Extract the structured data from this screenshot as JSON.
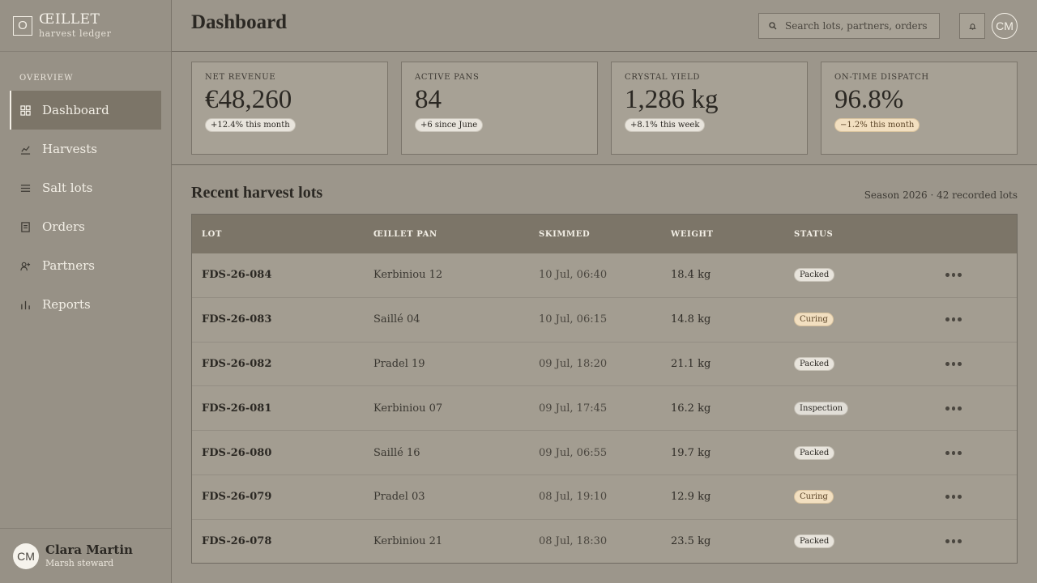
{
  "brand": {
    "mark": "O",
    "name": "ŒILLET",
    "sub": "harvest ledger"
  },
  "sidebar": {
    "section": "OVERVIEW",
    "items": [
      {
        "label": "Dashboard",
        "icon": "grid-icon",
        "active": true
      },
      {
        "label": "Harvests",
        "icon": "trend-chart-icon"
      },
      {
        "label": "Salt lots",
        "icon": "list-icon"
      },
      {
        "label": "Orders",
        "icon": "document-icon"
      },
      {
        "label": "Partners",
        "icon": "add-user-icon"
      },
      {
        "label": "Reports",
        "icon": "bar-chart-icon"
      }
    ]
  },
  "user": {
    "initials": "CM",
    "name": "Clara Martin",
    "role": "Marsh steward"
  },
  "header": {
    "title": "Dashboard",
    "search_placeholder": "Search lots, partners, orders",
    "avatar_initials": "CM"
  },
  "kpis": [
    {
      "label": "NET REVENUE",
      "value": "€48,260",
      "delta": "+12.4% this month",
      "tone": "positive"
    },
    {
      "label": "ACTIVE PANS",
      "value": "84",
      "delta": "+6 since June",
      "tone": "positive"
    },
    {
      "label": "CRYSTAL YIELD",
      "value": "1,286 kg",
      "delta": "+8.1% this week",
      "tone": "positive"
    },
    {
      "label": "ON-TIME DISPATCH",
      "value": "96.8%",
      "delta": "−1.2% this month",
      "tone": "warn"
    }
  ],
  "lots": {
    "title": "Recent harvest lots",
    "meta": "Season 2026 · 42 recorded lots",
    "columns": [
      "LOT",
      "ŒILLET PAN",
      "SKIMMED",
      "WEIGHT",
      "STATUS"
    ],
    "rows": [
      {
        "lot": "FDS-26-084",
        "pan": "Kerbiniou 12",
        "skimmed": "10 Jul, 06:40",
        "weight": "18.4 kg",
        "status": "Packed"
      },
      {
        "lot": "FDS-26-083",
        "pan": "Saillé 04",
        "skimmed": "10 Jul, 06:15",
        "weight": "14.8 kg",
        "status": "Curing"
      },
      {
        "lot": "FDS-26-082",
        "pan": "Pradel 19",
        "skimmed": "09 Jul, 18:20",
        "weight": "21.1 kg",
        "status": "Packed"
      },
      {
        "lot": "FDS-26-081",
        "pan": "Kerbiniou 07",
        "skimmed": "09 Jul, 17:45",
        "weight": "16.2 kg",
        "status": "Inspection"
      },
      {
        "lot": "FDS-26-080",
        "pan": "Saillé 16",
        "skimmed": "09 Jul, 06:55",
        "weight": "19.7 kg",
        "status": "Packed"
      },
      {
        "lot": "FDS-26-079",
        "pan": "Pradel 03",
        "skimmed": "08 Jul, 19:10",
        "weight": "12.9 kg",
        "status": "Curing"
      },
      {
        "lot": "FDS-26-078",
        "pan": "Kerbiniou 21",
        "skimmed": "08 Jul, 18:30",
        "weight": "23.5 kg",
        "status": "Packed"
      }
    ]
  },
  "colors": {
    "sidebar": "#979186",
    "accent": "#7c7568",
    "warn": "#f2dfc0",
    "page": "#9c968b"
  }
}
